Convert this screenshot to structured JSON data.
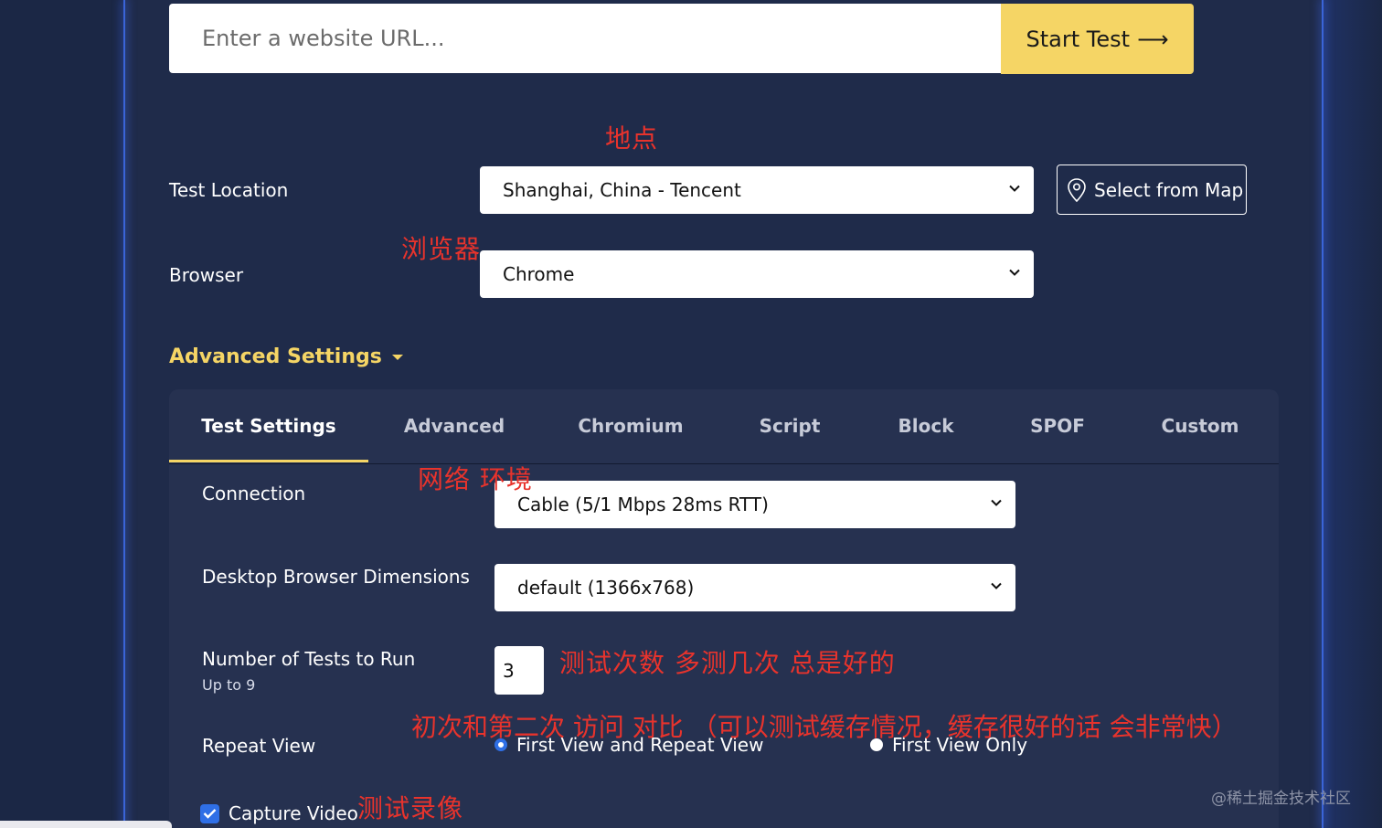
{
  "url_bar": {
    "placeholder": "Enter a website URL...",
    "button_label": "Start Test",
    "button_arrow": "⟶"
  },
  "test_location": {
    "label": "Test Location",
    "value": "Shanghai, China - Tencent",
    "map_button": "Select from Map"
  },
  "browser": {
    "label": "Browser",
    "value": "Chrome"
  },
  "advanced_settings": {
    "label": "Advanced Settings"
  },
  "tabs": [
    {
      "label": "Test Settings",
      "active": true
    },
    {
      "label": "Advanced"
    },
    {
      "label": "Chromium"
    },
    {
      "label": "Script"
    },
    {
      "label": "Block"
    },
    {
      "label": "SPOF"
    },
    {
      "label": "Custom"
    }
  ],
  "connection": {
    "label": "Connection",
    "value": "Cable (5/1 Mbps 28ms RTT)"
  },
  "dimensions": {
    "label": "Desktop Browser Dimensions",
    "value": "default (1366x768)"
  },
  "num_tests": {
    "label": "Number of Tests to Run",
    "sublabel": "Up to 9",
    "value": "3"
  },
  "repeat_view": {
    "label": "Repeat View",
    "option_1": "First View and Repeat View",
    "option_2": "First View Only",
    "selected": "First View and Repeat View"
  },
  "capture_video": {
    "label": "Capture Video",
    "checked": true
  },
  "annotations": {
    "location": "地点",
    "browser": "浏览器",
    "network": "网络 环境",
    "tests": "测试次数 多测几次 总是好的",
    "repeat": "初次和第二次 访问 对比 （可以测试缓存情况，缓存很好的话 会非常快）",
    "video": "测试录像"
  },
  "watermark": "@稀土掘金技术社区",
  "colors": {
    "accent": "#f5d565",
    "background": "#1f2b4a",
    "panel": "#263150",
    "annotation": "#e8332c",
    "radio": "#2f6fe6"
  }
}
